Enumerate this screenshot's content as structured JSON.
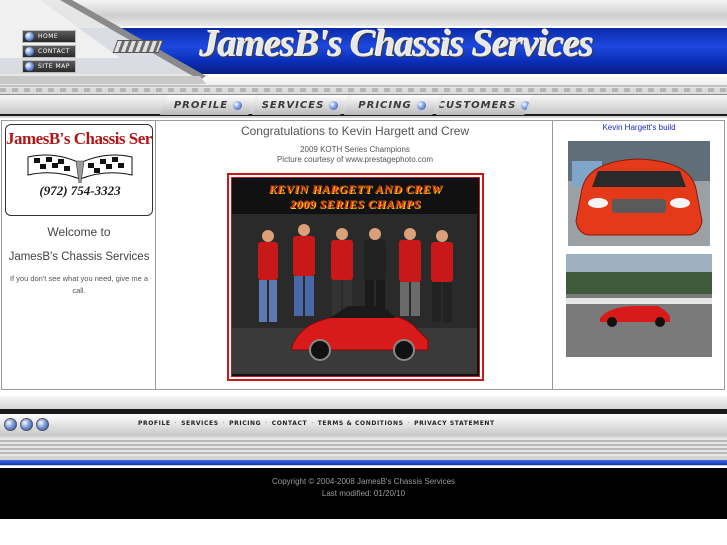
{
  "header": {
    "site_title": "JamesB's Chassis Services",
    "side_nav": [
      {
        "label": "HOME"
      },
      {
        "label": "CONTACT"
      },
      {
        "label": "SITE MAP"
      }
    ],
    "tabs": [
      {
        "label": "PROFILE"
      },
      {
        "label": "SERVICES"
      },
      {
        "label": "PRICING"
      },
      {
        "label": "CUSTOMERS"
      }
    ]
  },
  "left": {
    "logo_name": "JamesB's Chassis Services",
    "logo_phone": "(972) 754-3323",
    "welcome": "Welcome to",
    "company": "JamesB's Chassis Services",
    "help_note": "If you don't see what you need, give me a call."
  },
  "main": {
    "headline": "Congratulations to Kevin Hargett and Crew",
    "subline": "2009 KOTH Series Champions",
    "credit": "Picture courtesy of www.prestagephoto.com",
    "photo_caption_line1": "KEVIN HARGETT AND CREW",
    "photo_caption_line2": "2009 SERIES CHAMPS"
  },
  "right": {
    "build_title": "Kevin Hargett's build"
  },
  "footer": {
    "links": [
      {
        "label": "PROFILE"
      },
      {
        "label": "SERVICES"
      },
      {
        "label": "PRICING"
      },
      {
        "label": "CONTACT"
      },
      {
        "label": "TERMS & CONDITIONS"
      },
      {
        "label": "PRIVACY STATEMENT"
      }
    ],
    "link_separator": "·",
    "copyright": "Copyright © 2004-2008 JamesB's Chassis Services",
    "modified": "Last modified: 01/20/10"
  },
  "colors": {
    "header_blue": "#1d48e0",
    "accent_red": "#c81818",
    "link_blue": "#1c2ac0",
    "footer_black": "#000000"
  }
}
